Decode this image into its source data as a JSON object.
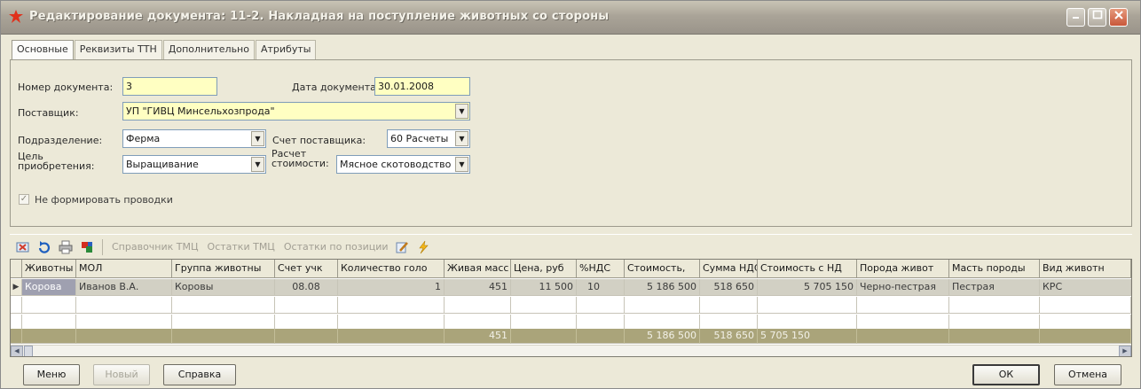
{
  "window": {
    "title": "Редактирование документа: 11-2. Накладная на поступление животных со стороны"
  },
  "tabs": [
    "Основные",
    "Реквизиты ТТН",
    "Дополнительно",
    "Атрибуты"
  ],
  "form": {
    "doc_number": {
      "label": "Номер документа:",
      "value": "3"
    },
    "doc_date": {
      "label": "Дата документа:",
      "value": "30.01.2008"
    },
    "supplier": {
      "label": "Поставщик:",
      "value": "УП \"ГИВЦ Минсельхозпрода\""
    },
    "department": {
      "label": "Подразделение:",
      "value": "Ферма"
    },
    "supplier_account": {
      "label": "Счет поставщика:",
      "value": "60 Расчеты"
    },
    "purpose": {
      "label1": "Цель",
      "label2": "приобретения:",
      "value": "Выращивание"
    },
    "cost_calc": {
      "label1": "Расчет",
      "label2": "стоимости:",
      "value": "Мясное скотоводство"
    },
    "no_postings": {
      "label": "Не формировать проводки",
      "checked": true
    }
  },
  "toolbar": {
    "links": [
      "Справочник ТМЦ",
      "Остатки ТМЦ",
      "Остатки по позиции"
    ]
  },
  "grid": {
    "columns": [
      "Животны",
      "МОЛ",
      "Группа животны",
      "Счет учк",
      "Количество голо",
      "Живая масс",
      "Цена, руб",
      "%НДС",
      "Стоимость,",
      "Сумма НДС",
      "Стоимость с НД",
      "Порода живот",
      "Масть породы",
      "Вид животн"
    ],
    "rows": [
      [
        "Корова",
        "Иванов В.А.",
        "Коровы",
        "08.08",
        "1",
        "451",
        "11 500",
        "10",
        "5 186 500",
        "518 650",
        "5 705 150",
        "Черно-пестрая",
        "Пестрая",
        "КРС"
      ]
    ],
    "totals": [
      "",
      "",
      "",
      "",
      "",
      "451",
      "",
      "",
      "5 186 500",
      "518 650",
      "5 705 150",
      "",
      "",
      ""
    ]
  },
  "buttons": {
    "menu": "Меню",
    "new": "Новый",
    "help": "Справка",
    "ok": "ОК",
    "cancel": "Отмена"
  }
}
